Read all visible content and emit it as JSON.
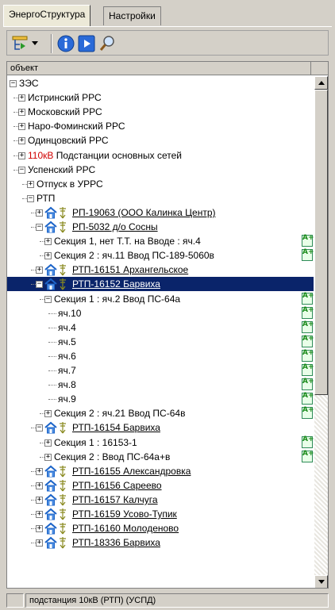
{
  "tabs": [
    {
      "label": "ЭнергоСтруктура",
      "active": true
    },
    {
      "label": "Настройки",
      "active": false
    }
  ],
  "toolbar": {
    "buttons": [
      {
        "icon": "filter-tree-icon"
      },
      {
        "icon": "dropdown-arrow-icon"
      },
      {
        "icon": "info-icon"
      },
      {
        "icon": "play-icon"
      },
      {
        "icon": "search-icon"
      }
    ]
  },
  "column_header": "объект",
  "tree": [
    {
      "level": 0,
      "exp": "minus",
      "label": "ЗЭС"
    },
    {
      "level": 1,
      "exp": "plus",
      "label": "Истринский РРС"
    },
    {
      "level": 1,
      "exp": "plus",
      "label": "Московский РРС"
    },
    {
      "level": 1,
      "exp": "plus",
      "label": "Наро-Фоминский РРС"
    },
    {
      "level": 1,
      "exp": "plus",
      "label": "Одинцовский РРС"
    },
    {
      "level": 1,
      "exp": "plus",
      "prefix": "110кВ",
      "label": "Подстанции основных сетей"
    },
    {
      "level": 1,
      "exp": "minus",
      "label": "Успенский РРС"
    },
    {
      "level": 2,
      "exp": "plus",
      "label": "Отпуск в УРРС"
    },
    {
      "level": 2,
      "exp": "minus",
      "label": "РТП"
    },
    {
      "level": 3,
      "exp": "plus",
      "icons": true,
      "link": true,
      "label": "РП-19063 (ООО Калинка Центр)"
    },
    {
      "level": 3,
      "exp": "minus",
      "icons": true,
      "link": true,
      "label": "РП-5032 д/о Сосны"
    },
    {
      "level": 4,
      "exp": "plus",
      "label": "Секция 1, нет Т.Т. на Вводе : яч.4",
      "badge": true
    },
    {
      "level": 4,
      "exp": "plus",
      "label": "Секция 2 : яч.11 Ввод ПС-189-5060в",
      "badge": true
    },
    {
      "level": 3,
      "exp": "plus",
      "icons": true,
      "link": true,
      "label": "РТП-16151  Архангельское"
    },
    {
      "level": 3,
      "exp": "minus",
      "icons": true,
      "link": true,
      "selected": true,
      "label": "РТП-16152 Барвиха"
    },
    {
      "level": 4,
      "exp": "minus",
      "label": "Секция 1 : яч.2 Ввод ПС-64а",
      "badge": true
    },
    {
      "level": 5,
      "label": "яч.10",
      "badge": true
    },
    {
      "level": 5,
      "label": "яч.4",
      "badge": true
    },
    {
      "level": 5,
      "label": "яч.5",
      "badge": true
    },
    {
      "level": 5,
      "label": "яч.6",
      "badge": true
    },
    {
      "level": 5,
      "label": "яч.7",
      "badge": true
    },
    {
      "level": 5,
      "label": "яч.8",
      "badge": true
    },
    {
      "level": 5,
      "label": "яч.9",
      "badge": true
    },
    {
      "level": 4,
      "exp": "plus",
      "label": "Секция 2 : яч.21 Ввод ПС-64в",
      "badge": true
    },
    {
      "level": 3,
      "exp": "minus",
      "icons": true,
      "link": true,
      "label": "РТП-16154 Барвиха"
    },
    {
      "level": 4,
      "exp": "plus",
      "label": "Секция 1 : 16153-1",
      "badge": true
    },
    {
      "level": 4,
      "exp": "plus",
      "label": "Секция 2 : Ввод ПС-64а+в",
      "badge": true
    },
    {
      "level": 3,
      "exp": "plus",
      "icons": true,
      "link": true,
      "label": "РТП-16155 Александровка"
    },
    {
      "level": 3,
      "exp": "plus",
      "icons": true,
      "link": true,
      "label": "РТП-16156 Сареево"
    },
    {
      "level": 3,
      "exp": "plus",
      "icons": true,
      "link": true,
      "label": "РТП-16157 Калчуга"
    },
    {
      "level": 3,
      "exp": "plus",
      "icons": true,
      "link": true,
      "label": "РТП-16159 Усово-Тупик"
    },
    {
      "level": 3,
      "exp": "plus",
      "icons": true,
      "link": true,
      "label": "РТП-16160 Молоденово"
    },
    {
      "level": 3,
      "exp": "plus",
      "icons": true,
      "link": true,
      "label": "РТП-18336 Барвиха"
    }
  ],
  "badge_text": "А+",
  "status": {
    "text": "подстанция 10кВ (РТП) (УСПД)"
  }
}
